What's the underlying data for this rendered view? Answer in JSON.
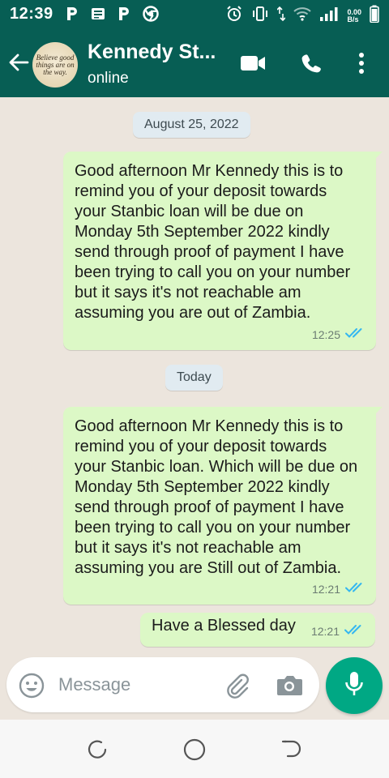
{
  "status_bar": {
    "time": "12:39",
    "net_speed_value": "0.00",
    "net_speed_unit": "B/s"
  },
  "header": {
    "contact_name": "Kennedy St...",
    "contact_status": "online",
    "avatar_text": "Believe good things are on the way."
  },
  "chat": {
    "date_chip_1": "August 25, 2022",
    "date_chip_2": "Today",
    "messages": [
      {
        "text": "Good afternoon Mr Kennedy this is to remind you of your deposit towards your Stanbic loan will be due on Monday 5th September 2022 kindly send through proof of payment I have been trying to call you on your number but it says it's not reachable am assuming you are out of Zambia.",
        "time": "12:25",
        "status": "read"
      },
      {
        "text": "Good afternoon Mr Kennedy this is to remind you of your deposit towards your Stanbic loan. Which will be due on Monday 5th September 2022 kindly send through proof of payment I have been trying to call you on your number but it says it's not reachable am assuming you are Still out of Zambia.",
        "time": "12:21",
        "status": "read"
      },
      {
        "text": "Have a Blessed day",
        "time": "12:21",
        "status": "read"
      }
    ]
  },
  "input": {
    "placeholder": "Message"
  },
  "colors": {
    "header": "#075E54",
    "bubble_out": "#DCF8C6",
    "chat_bg": "#ECE5DD",
    "accent": "#00A884",
    "read_ticks": "#34B7F1"
  }
}
